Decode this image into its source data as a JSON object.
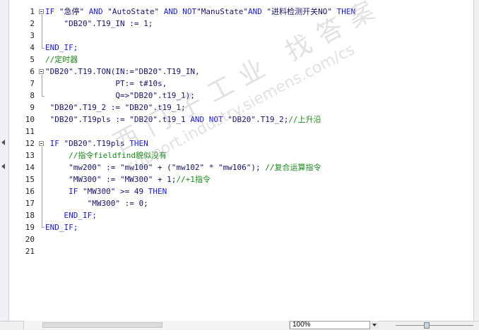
{
  "editor": {
    "line_numbers": [
      "1",
      "2",
      "3",
      "4",
      "5",
      "6",
      "7",
      "8",
      "9",
      "10",
      "11",
      "12",
      "13",
      "14",
      "15",
      "16",
      "17",
      "18",
      "19",
      "20",
      "21"
    ],
    "lines": [
      [
        {
          "t": "IF ",
          "c": "kw"
        },
        {
          "t": "\"急停\"",
          "c": "str"
        },
        {
          "t": " AND ",
          "c": "kw"
        },
        {
          "t": "\"AutoState\"",
          "c": "str"
        },
        {
          "t": " AND ",
          "c": "kw"
        },
        {
          "t": "NOT",
          "c": "kw"
        },
        {
          "t": "\"ManuState\"",
          "c": "str"
        },
        {
          "t": "AND ",
          "c": "kw"
        },
        {
          "t": "\"进料检测开关NO\"",
          "c": "str"
        },
        {
          "t": " THEN",
          "c": "kw"
        }
      ],
      [
        {
          "t": "    \"DB20\".T19_IN := 1;",
          "c": "txt"
        }
      ],
      [],
      [
        {
          "t": "END_IF;",
          "c": "kw"
        }
      ],
      [
        {
          "t": "//定时器",
          "c": "cm"
        }
      ],
      [
        {
          "t": "\"DB20\".T19.",
          "c": "txt"
        },
        {
          "t": "TON",
          "c": "txt"
        },
        {
          "t": "(IN:=\"DB20\".T19_IN,",
          "c": "txt"
        }
      ],
      [
        {
          "t": "               PT:= t#10s,",
          "c": "txt"
        }
      ],
      [
        {
          "t": "               Q=>\"DB20\".t19_1);",
          "c": "txt"
        }
      ],
      [
        {
          "t": " \"DB20\".T19_2 := \"DB20\".t19_1;",
          "c": "txt"
        }
      ],
      [
        {
          "t": " \"DB20\".T19pls := \"DB20\".t19_1 ",
          "c": "txt"
        },
        {
          "t": "AND NOT",
          "c": "kw"
        },
        {
          "t": " \"DB20\".T19_2;",
          "c": "txt"
        },
        {
          "t": "//上升沿",
          "c": "cm"
        }
      ],
      [],
      [
        {
          "t": " IF ",
          "c": "kw"
        },
        {
          "t": "\"DB20\".T19pls ",
          "c": "txt"
        },
        {
          "t": "THEN",
          "c": "kw"
        }
      ],
      [
        {
          "t": "     //指令fieldfind貌似没有",
          "c": "cm"
        }
      ],
      [
        {
          "t": "     \"mw200\" := \"mw100\" + (\"mw102\" * \"mw106\"); ",
          "c": "txt"
        },
        {
          "t": "//复合运算指令",
          "c": "cm"
        }
      ],
      [
        {
          "t": "     \"MW300\" := \"MW300\" + 1;",
          "c": "txt"
        },
        {
          "t": "//+1指令",
          "c": "cm"
        }
      ],
      [
        {
          "t": "     IF ",
          "c": "kw"
        },
        {
          "t": "\"MW300\" >= 49 ",
          "c": "txt"
        },
        {
          "t": "THEN",
          "c": "kw"
        }
      ],
      [
        {
          "t": "         \"MW300\" := 0;",
          "c": "txt"
        }
      ],
      [
        {
          "t": "    END_IF;",
          "c": "kw"
        }
      ],
      [
        {
          "t": "END_IF;",
          "c": "kw"
        }
      ],
      [],
      []
    ]
  },
  "status": {
    "zoom": "100%"
  },
  "watermark": {
    "chinese": "西门子工业 找答案",
    "url": "support.industry.siemens.com/cs"
  }
}
